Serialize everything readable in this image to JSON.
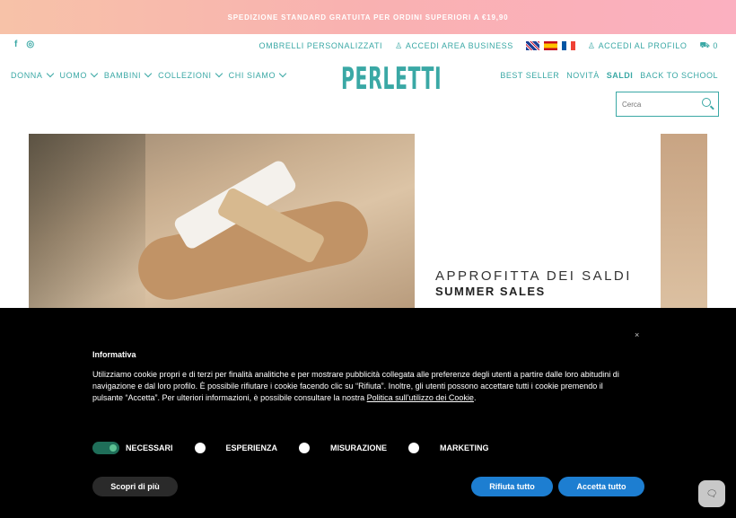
{
  "promo": {
    "text": "SPEDIZIONE STANDARD GRATUITA PER ORDINI SUPERIORI A €19,90"
  },
  "social": {
    "facebook": "f",
    "instagram": "◎"
  },
  "toplinks": {
    "ombrelli": "OMBRELLI PERSONALIZZATI",
    "business": "ACCEDI AREA BUSINESS",
    "profile": "ACCEDI AL PROFILO",
    "cart_count": "0"
  },
  "nav": {
    "items": [
      "DONNA",
      "UOMO",
      "BAMBINI",
      "COLLEZIONI",
      "CHI SIAMO"
    ]
  },
  "logo": {
    "text": "PERLETTI"
  },
  "rnav": {
    "best": "BEST SELLER",
    "novita": "NOVITÀ",
    "saldi": "SALDI",
    "school": "BACK TO SCHOOL"
  },
  "search": {
    "placeholder": "Cerca"
  },
  "banner": {
    "line1": "APPROFITTA DEI SALDI",
    "line2": "SUMMER SALES"
  },
  "cookie": {
    "close": "×",
    "title": "Informativa",
    "text": "Utilizziamo cookie propri e di terzi per finalità analitiche e per mostrare pubblicità collegata alle preferenze degli utenti a partire dalle loro abitudini di navigazione e dal loro profilo. È possibile rifiutare i cookie facendo clic su “Rifiuta”. Inoltre, gli utenti possono accettare tutti i cookie premendo il pulsante “Accetta”. Per ulteriori informazioni, è possibile consultare la nostra ",
    "link": "Politica sull'utilizzo dei Cookie",
    "end": ".",
    "options": {
      "necessari": "NECESSARI",
      "esperienza": "ESPERIENZA",
      "misurazione": "MISURAZIONE",
      "marketing": "MARKETING"
    },
    "more": "Scopri di più",
    "reject": "Rifiuta tutto",
    "accept": "Accetta tutto"
  },
  "chat": {
    "icon": "chat-icon"
  }
}
